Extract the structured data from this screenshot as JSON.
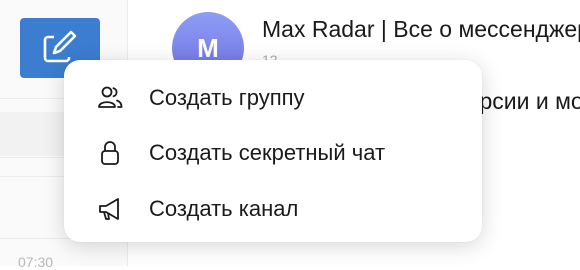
{
  "chat": {
    "avatar_letter": "M",
    "title": "Max Radar | Все о мессенджерах",
    "meta": "12",
    "preview": "...о выходе новой версии и моды, как"
  },
  "left_pane": {
    "time": "07:30"
  },
  "menu": {
    "items": [
      {
        "label": "Создать группу",
        "icon": "people-icon"
      },
      {
        "label": "Создать секретный чат",
        "icon": "lock-icon"
      },
      {
        "label": "Создать канал",
        "icon": "megaphone-icon"
      }
    ]
  },
  "colors": {
    "accent": "#3c7dd0",
    "avatar": "#7c82ec"
  }
}
